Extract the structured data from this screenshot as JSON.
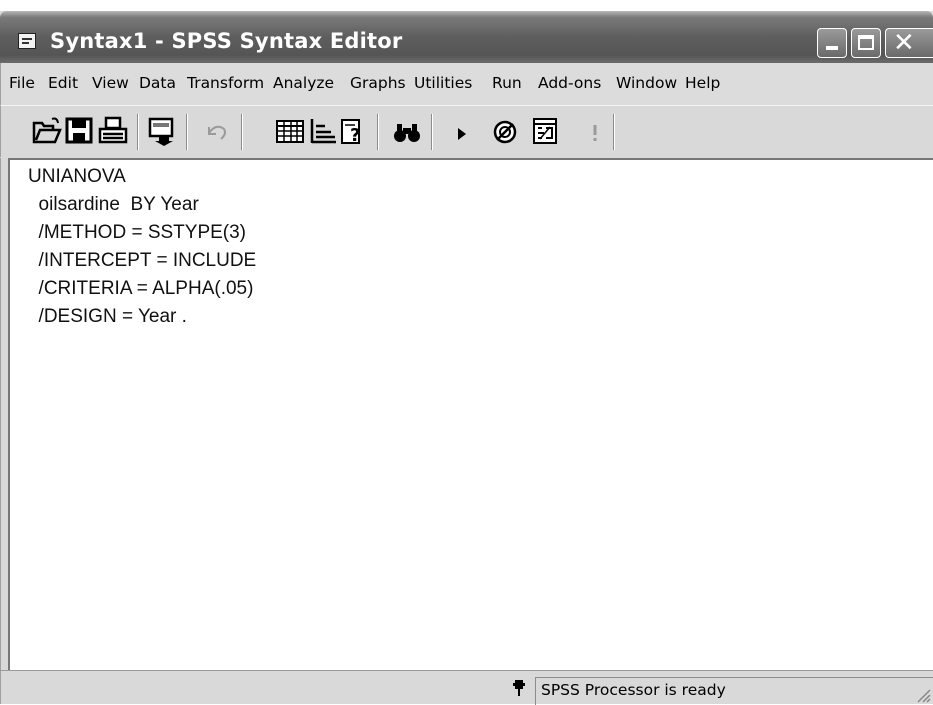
{
  "window": {
    "title": "Syntax1 - SPSS Syntax Editor"
  },
  "menu": {
    "items": [
      "File",
      "Edit",
      "View",
      "Data",
      "Transform",
      "Analyze",
      "Graphs",
      "Utilities",
      "Run",
      "Add-ons",
      "Window",
      "Help"
    ]
  },
  "toolbar": {
    "buttons": [
      "open-icon",
      "save-icon",
      "print-icon",
      "dialog-recall-icon",
      "undo-icon",
      "goto-data-icon",
      "variables-icon",
      "syntax-help-icon",
      "find-icon",
      "run-icon",
      "use-sets-icon",
      "syntax-dialog-icon",
      "designate-window-icon"
    ]
  },
  "editor": {
    "lines": [
      "UNIANOVA",
      "  oilsardine  BY Year",
      "  /METHOD = SSTYPE(3)",
      "  /INTERCEPT = INCLUDE",
      "  /CRITERIA = ALPHA(.05)",
      "  /DESIGN = Year ."
    ]
  },
  "status": {
    "text": "SPSS Processor  is ready"
  }
}
